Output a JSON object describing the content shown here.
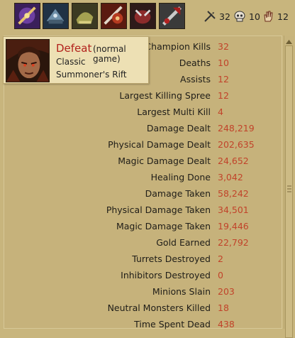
{
  "items": [
    {
      "name": "item-1-icon",
      "color": "#4b2a6b"
    },
    {
      "name": "item-2-icon",
      "color": "#345068"
    },
    {
      "name": "item-3-icon",
      "color": "#6b6a3a"
    },
    {
      "name": "item-4-icon",
      "color": "#7a2a1c"
    },
    {
      "name": "item-5-icon",
      "color": "#4a2a2a"
    },
    {
      "name": "item-6-icon",
      "color": "#5a5a5a"
    }
  ],
  "kda": {
    "kills": "32",
    "deaths": "10",
    "assists": "12"
  },
  "game": {
    "result": "Defeat",
    "mode": "(normal game)",
    "type": "Classic",
    "map": "Summoner's Rift"
  },
  "stats": [
    {
      "label": "Champion Kills",
      "value": "32"
    },
    {
      "label": "Deaths",
      "value": "10"
    },
    {
      "label": "Assists",
      "value": "12"
    },
    {
      "label": "Largest Killing Spree",
      "value": "12"
    },
    {
      "label": "Largest Multi Kill",
      "value": "4"
    },
    {
      "label": "Damage Dealt",
      "value": "248,219"
    },
    {
      "label": "Physical Damage Dealt",
      "value": "202,635"
    },
    {
      "label": "Magic Damage Dealt",
      "value": "24,652"
    },
    {
      "label": "Healing Done",
      "value": "3,042"
    },
    {
      "label": "Damage Taken",
      "value": "58,242"
    },
    {
      "label": "Physical Damage Taken",
      "value": "34,501"
    },
    {
      "label": "Magic Damage Taken",
      "value": "19,446"
    },
    {
      "label": "Gold Earned",
      "value": "22,792"
    },
    {
      "label": "Turrets Destroyed",
      "value": "2"
    },
    {
      "label": "Inhibitors Destroyed",
      "value": "0"
    },
    {
      "label": "Minions Slain",
      "value": "203"
    },
    {
      "label": "Neutral Monsters Killed",
      "value": "18"
    },
    {
      "label": "Time Spent Dead",
      "value": "438"
    }
  ]
}
